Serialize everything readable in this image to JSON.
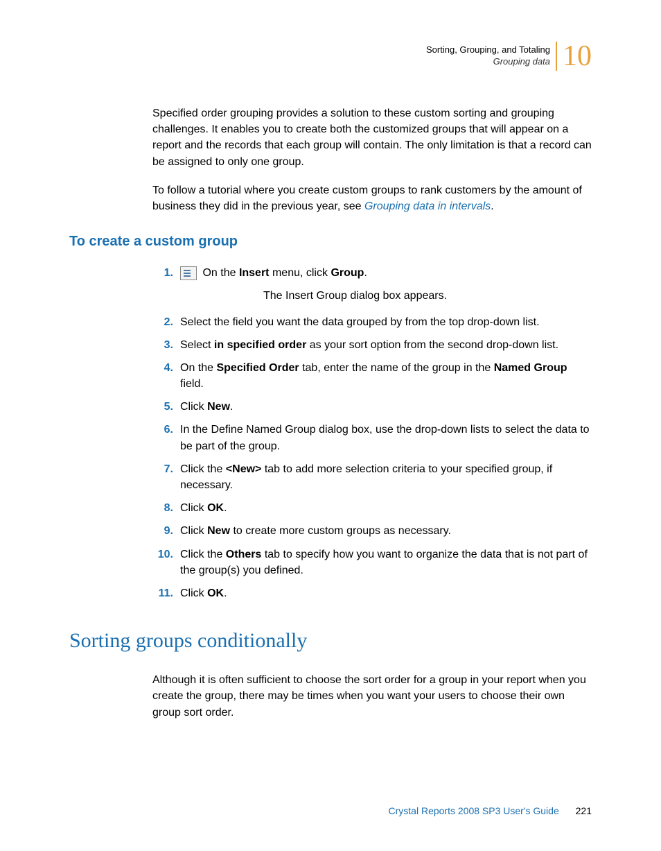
{
  "header": {
    "title": "Sorting, Grouping, and Totaling",
    "subtitle": "Grouping data",
    "chapter": "10"
  },
  "intro": {
    "p1": "Specified order grouping provides a solution to these custom sorting and grouping challenges. It enables you to create both the customized groups that will appear on a report and the records that each group will contain. The only limitation is that a record can be assigned to only one group.",
    "p2a": "To follow a tutorial where you create custom groups to rank customers by the amount of business they did in the previous year, see ",
    "p2link": "Grouping data in intervals",
    "p2b": "."
  },
  "section1": {
    "heading": "To create a custom group",
    "steps": [
      {
        "n": "1.",
        "pre": "On the ",
        "b1": "Insert",
        "mid": " menu, click ",
        "b2": "Group",
        "post": ".",
        "hasIcon": true
      },
      {
        "note": "The Insert Group dialog box appears."
      },
      {
        "n": "2.",
        "text": "Select the field you want the data grouped by from the top drop-down list."
      },
      {
        "n": "3.",
        "pre": "Select ",
        "b1": "in specified order",
        "post": " as your sort option from the second drop-down list."
      },
      {
        "n": "4.",
        "pre": "On the ",
        "b1": "Specified Order",
        "mid": " tab, enter the name of the group in the ",
        "b2": "Named Group",
        "post": " field."
      },
      {
        "n": "5.",
        "pre": "Click ",
        "b1": "New",
        "post": "."
      },
      {
        "n": "6.",
        "text": "In the Define Named Group dialog box, use the drop-down lists to select the data to be part of the group."
      },
      {
        "n": "7.",
        "pre": "Click the ",
        "b1": "<New>",
        "post": " tab to add more selection criteria to your specified group, if necessary."
      },
      {
        "n": "8.",
        "pre": "Click ",
        "b1": "OK",
        "post": "."
      },
      {
        "n": "9.",
        "pre": "Click ",
        "b1": "New",
        "post": " to create more custom groups as necessary."
      },
      {
        "n": "10.",
        "pre": "Click the ",
        "b1": "Others",
        "post": " tab to specify how you want to organize the data that is not part of the group(s) you defined."
      },
      {
        "n": "11.",
        "pre": "Click ",
        "b1": "OK",
        "post": "."
      }
    ]
  },
  "section2": {
    "heading": "Sorting groups conditionally",
    "p1": "Although it is often sufficient to choose the sort order for a group in your report when you create the group, there may be times when you want your users to choose their own group sort order."
  },
  "footer": {
    "title": "Crystal Reports 2008 SP3 User's Guide",
    "page": "221"
  }
}
